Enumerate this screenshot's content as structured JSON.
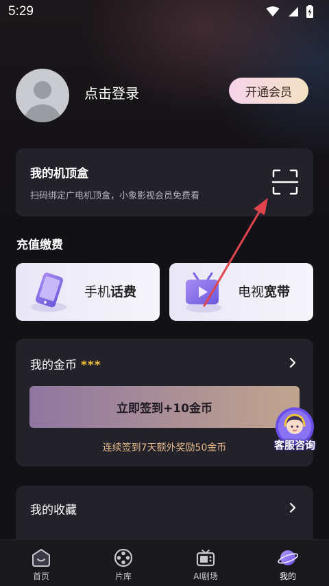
{
  "status_bar": {
    "time": "5:29",
    "icons": [
      "wifi-icon",
      "signal-icon",
      "battery-charging-icon"
    ]
  },
  "profile": {
    "login_text": "点击登录",
    "vip_button": "开通会员"
  },
  "stb_card": {
    "title": "我的机顶盒",
    "subtitle": "扫码绑定广电机顶盒，小象影视会员免费看",
    "scan_icon": "scan-icon"
  },
  "recharge": {
    "section_title": "充值缴费",
    "items": [
      {
        "prefix": "手机",
        "bold": "话费",
        "icon": "phone-icon"
      },
      {
        "prefix": "电视",
        "bold": "宽带",
        "icon": "tv-icon"
      }
    ]
  },
  "coins": {
    "title": "我的金币",
    "stars": "***",
    "checkin_button": "立即签到+10金币",
    "note": "连续签到7天额外奖励50金币"
  },
  "favorites": {
    "title": "我的收藏"
  },
  "support": {
    "label": "客服咨询"
  },
  "tabbar": {
    "tabs": [
      {
        "label": "首页",
        "icon": "home-icon"
      },
      {
        "label": "片库",
        "icon": "film-reel-icon"
      },
      {
        "label": "AI剧场",
        "icon": "tv-theater-icon"
      },
      {
        "label": "我的",
        "icon": "profile-planet-icon",
        "active": true
      }
    ]
  },
  "colors": {
    "accent_gold": "#f2c23a",
    "note_text": "#e5b98a",
    "annotation_arrow": "#e0454d"
  }
}
